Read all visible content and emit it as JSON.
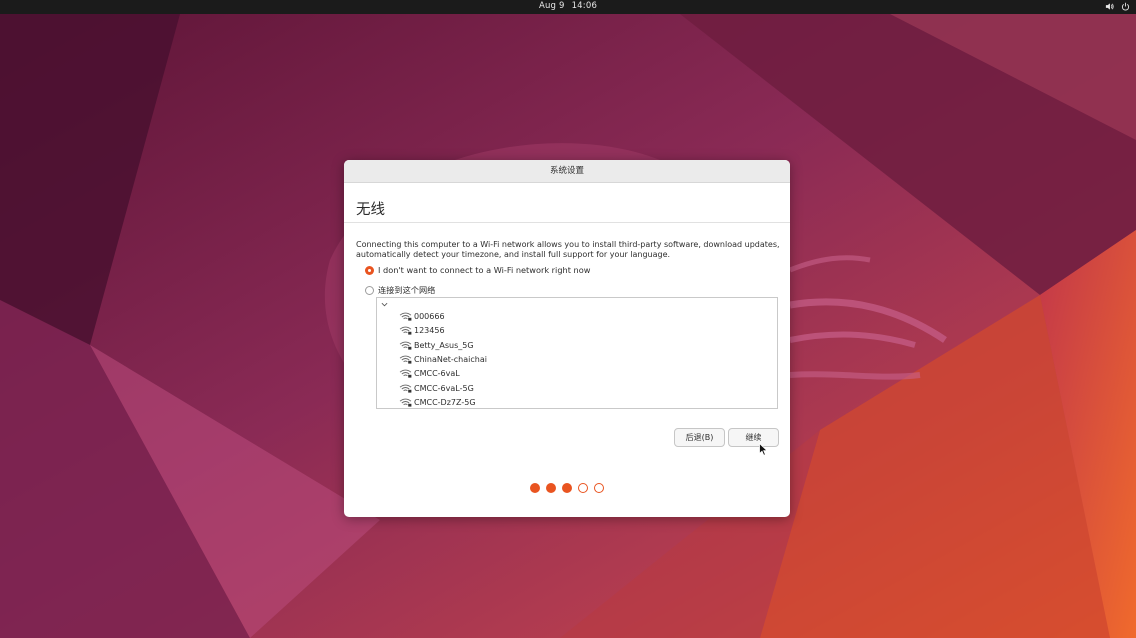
{
  "topbar": {
    "date": "Aug 9",
    "time": "14:06",
    "icons": [
      "volume-icon",
      "power-icon"
    ]
  },
  "dialog": {
    "title": "系统设置",
    "heading": "无线",
    "description": "Connecting this computer to a Wi-Fi network allows you to install third-party software, download updates, automatically detect your timezone, and install full support for your language.",
    "options": [
      {
        "label": "I don't want to connect to a Wi-Fi network right now",
        "selected": true
      },
      {
        "label": "连接到这个网络",
        "selected": false
      }
    ],
    "networks": [
      {
        "ssid": "000666",
        "icon": "wifi-secure-icon"
      },
      {
        "ssid": "123456",
        "icon": "wifi-secure-icon"
      },
      {
        "ssid": "Betty_Asus_5G",
        "icon": "wifi-secure-icon"
      },
      {
        "ssid": "ChinaNet-chaichai",
        "icon": "wifi-secure-icon"
      },
      {
        "ssid": "CMCC-6vaL",
        "icon": "wifi-secure-icon"
      },
      {
        "ssid": "CMCC-6vaL-5G",
        "icon": "wifi-secure-icon"
      },
      {
        "ssid": "CMCC-Dz7Z-5G",
        "icon": "wifi-secure-icon"
      }
    ],
    "buttons": {
      "back": "后退(B)",
      "continue": "继续"
    },
    "progress": {
      "total_steps": 5,
      "completed_steps": 3
    },
    "accent_color": "#e95420"
  }
}
